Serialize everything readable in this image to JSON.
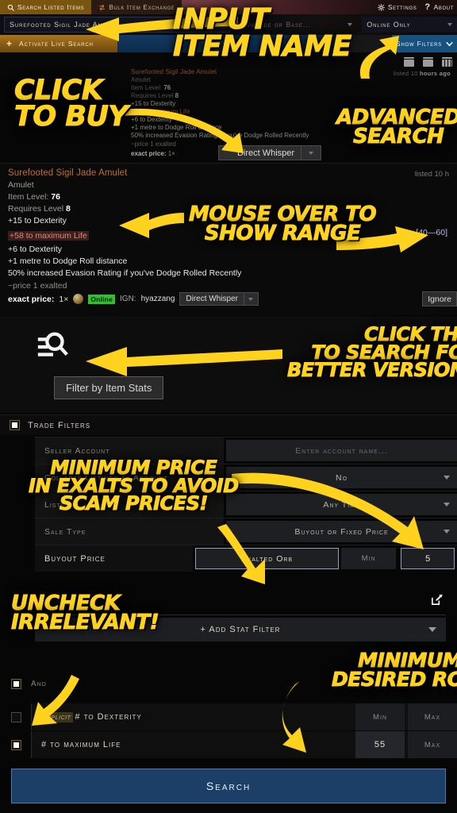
{
  "tabs": {
    "search_listed": "Search Listed Items",
    "bulk_exchange": "Bulk Item Exchange",
    "settings": "Settings",
    "about": "About"
  },
  "search": {
    "item_name_value": "Surefooted Sigil Jade Amulet",
    "middle_placeholder": "Upgrade or Base...",
    "online_filter": "Online Only",
    "live_search_label": "Activate Live Search",
    "live_search_plus": "+",
    "show_filters_label": "Show Filters",
    "blue_bar_label": "Search"
  },
  "results": {
    "listed_ago": "listed 10 hours ago",
    "listed_ago_prefix": "listed 10 ",
    "listed_ago_bold": "hours ago",
    "listed_right": "listed 10 h"
  },
  "ghost_listing": {
    "name": "Surefooted Sigil Jade Amulet",
    "type": "Amulet",
    "item_level_label": "Item Level: ",
    "item_level": "76",
    "requires_label": "Requires Level ",
    "requires": "8",
    "mod1": "+15 to Dexterity",
    "mod2": "+58 to maximum Life",
    "mod3": "+6 to Dexterity",
    "mod4": "+1 metre to Dodge Roll distance",
    "mod5": "50% increased Evasion Rating if you've Dodge Rolled Recently",
    "price_note": "~price 1 exalted",
    "exact_price_label": "exact price:",
    "exact_price_amount": "1×",
    "direct_whisper": "Direct Whisper"
  },
  "listing": {
    "name": "Surefooted Sigil Jade Amulet",
    "type": "Amulet",
    "item_level_label": "Item Level: ",
    "item_level": "76",
    "requires_label": "Requires Level ",
    "requires": "8",
    "mods": [
      "+15 to Dexterity",
      "+58 to maximum Life",
      "+6 to Dexterity",
      "+1 metre to Dodge Roll distance",
      "50% increased Evasion Rating if you've Dodge Rolled Recently"
    ],
    "highlighted_mod_index": 1,
    "mod_range": "[40—60]",
    "price_note": "~price 1 exalted",
    "exact_price_label": "exact price:",
    "exact_price_amount": "1×",
    "online_badge": "Online",
    "ign_label": "IGN:",
    "ign_value": "hyazzang",
    "direct_whisper": "Direct Whisper",
    "ignore_label": "Ignore"
  },
  "stats_callout": {
    "tooltip": "Filter by Item Stats"
  },
  "trade_filters": {
    "title": "Trade Filters",
    "rows": [
      {
        "label": "Seller Account",
        "value": "Enter account name...",
        "placeholder": true,
        "dropdown": false
      },
      {
        "label": "Collapse Listings by Account",
        "value": "No",
        "placeholder": false,
        "dropdown": true
      },
      {
        "label": "Listed",
        "value": "Any Time",
        "placeholder": false,
        "dropdown": true
      },
      {
        "label": "Sale Type",
        "value": "Buyout or Fixed Price",
        "placeholder": false,
        "dropdown": true
      }
    ],
    "buyout": {
      "label": "Buyout Price",
      "currency": "Exalted Orb",
      "min_placeholder": "Min",
      "max_value": "5"
    }
  },
  "stat_filters": {
    "add_stat_filter": "+ Add Stat Filter",
    "group_label": "And",
    "rows": [
      {
        "prefix": "Implicit",
        "name": "# to Dexterity",
        "checked": false,
        "min": "Min",
        "min_filled": false,
        "max": "Max"
      },
      {
        "prefix": "",
        "name": "# to maximum Life",
        "checked": true,
        "min": "55",
        "min_filled": true,
        "max": "Max"
      }
    ]
  },
  "search_button": {
    "label": "Search"
  },
  "annotations": [
    {
      "id": "input-item-name",
      "lines": "INPUT\nITEM NAME"
    },
    {
      "id": "advanced-search",
      "lines": "ADVANCED\nSEARCH"
    },
    {
      "id": "click-to-buy",
      "lines": "CLICK\nTO BUY"
    },
    {
      "id": "mouse-over-range",
      "lines": "MOUSE OVER TO\nSHOW RANGE"
    },
    {
      "id": "click-better",
      "lines": "CLICK THIS\nTO SEARCH FOR\nBETTER VERSIONS"
    },
    {
      "id": "minimum-price",
      "lines": "MINIMUM PRICE\nIN EXALTS TO AVOID\nSCAM PRICES!"
    },
    {
      "id": "uncheck-irrelevant",
      "lines": "UNCHECK\nIRRELEVANT!"
    },
    {
      "id": "minimum-roll",
      "lines": "MINIMUM\nDESIRED ROLL"
    }
  ],
  "colors": {
    "annotation": "#ffd21e",
    "rare_item": "#c06f2b",
    "highlight_mod": "#e2867a",
    "range_text": "#b9bbe6",
    "online": "#2fbf2f",
    "accent_blue": "#17527f",
    "live_search": "#a9741d"
  }
}
